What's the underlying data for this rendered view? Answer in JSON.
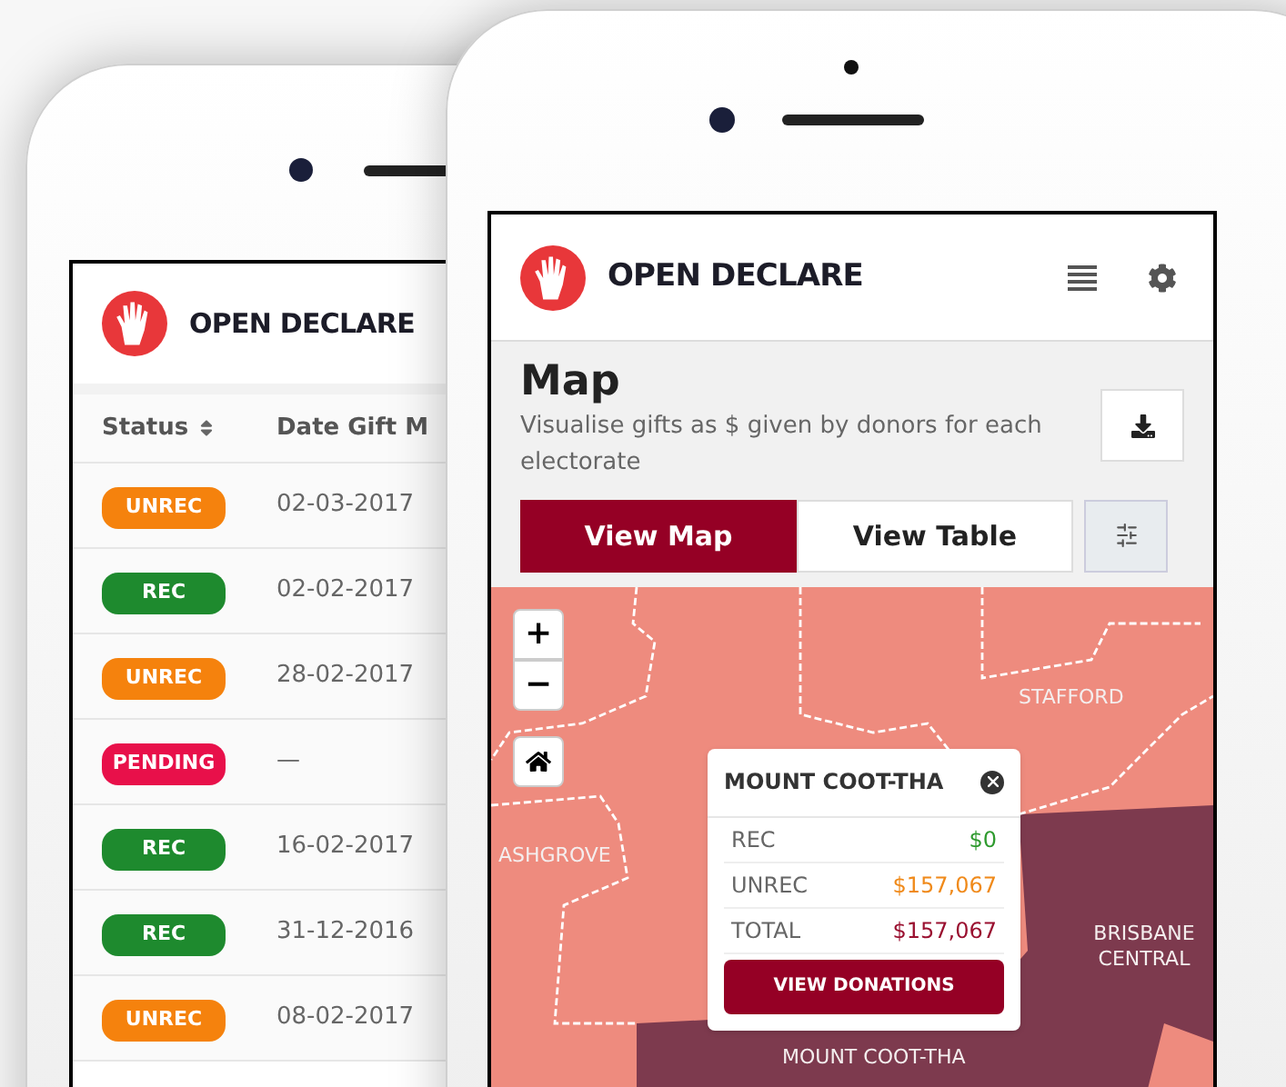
{
  "back_phone": {
    "brand": "OPEN DECLARE",
    "table": {
      "columns": [
        {
          "label": "Status",
          "sortable": true
        },
        {
          "label": "Date Gift M",
          "sortable": false
        }
      ],
      "rows": [
        {
          "status": "UNREC",
          "color": "#f5820d",
          "date": "02-03-2017"
        },
        {
          "status": "REC",
          "color": "#1e8a2e",
          "date": "02-02-2017"
        },
        {
          "status": "UNREC",
          "color": "#f5820d",
          "date": "28-02-2017"
        },
        {
          "status": "PENDING",
          "color": "#e8104a",
          "date": "—"
        },
        {
          "status": "REC",
          "color": "#1e8a2e",
          "date": "16-02-2017"
        },
        {
          "status": "REC",
          "color": "#1e8a2e",
          "date": "31-12-2016"
        },
        {
          "status": "UNREC",
          "color": "#f5820d",
          "date": "08-02-2017"
        }
      ]
    }
  },
  "front_phone": {
    "brand": "OPEN DECLARE",
    "title": "Map",
    "subtitle": "Visualise gifts as $ given by donors for each electorate",
    "tabs": [
      {
        "label": "View Map",
        "selected": true
      },
      {
        "label": "View Table",
        "selected": false
      }
    ],
    "map": {
      "zoom_in": "+",
      "zoom_out": "−",
      "labels": [
        {
          "kind": "north",
          "text": "STAFFORD"
        },
        {
          "kind": "west",
          "text": "ASHGROVE"
        },
        {
          "kind": "east",
          "text": "BRISBANE CENTRAL"
        },
        {
          "kind": "south",
          "text": "MOUNT COOT-THA"
        }
      ],
      "popup": {
        "title": "MOUNT COOT-THA",
        "rows": [
          {
            "label": "REC",
            "value": "$0",
            "color": "#2e9a2e"
          },
          {
            "label": "UNREC",
            "value": "$157,067",
            "color": "#f08a1a"
          },
          {
            "label": "TOTAL",
            "value": "$157,067",
            "color": "#9a1030"
          }
        ],
        "button": "VIEW DONATIONS"
      }
    }
  }
}
